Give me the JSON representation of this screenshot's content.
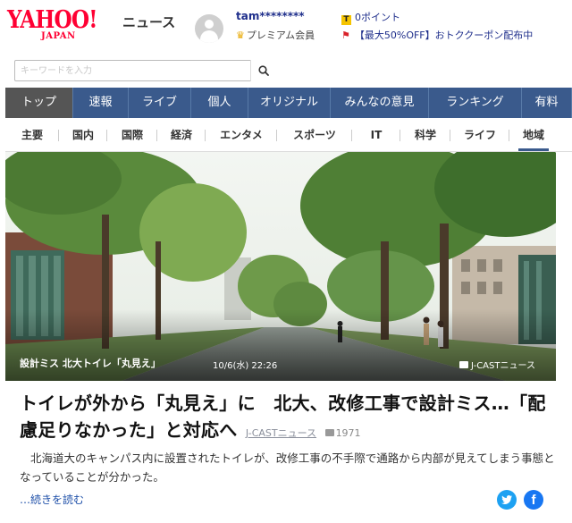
{
  "header": {
    "logo_text": "YAHOO!",
    "logo_sub": "JAPAN",
    "service_name": "ニュース",
    "username": "tam********",
    "premium_label": "プレミアム会員",
    "points_label": "0ポイント",
    "coupon_label": "【最大50%OFF】おトククーポン配布中"
  },
  "search": {
    "placeholder": "キーワードを入力"
  },
  "main_nav": {
    "items": [
      "トップ",
      "速報",
      "ライブ",
      "個人",
      "オリジナル",
      "みんなの意見",
      "ランキング",
      "有料"
    ],
    "active": "トップ"
  },
  "category_nav": {
    "items": [
      "主要",
      "国内",
      "国際",
      "経済",
      "エンタメ",
      "スポーツ",
      "IT",
      "科学",
      "ライフ",
      "地域"
    ],
    "active": "地域"
  },
  "photo": {
    "caption": "設計ミス 北大トイレ「丸見え」",
    "date": "10/6(水) 22:26",
    "source": "J-CASTニュース"
  },
  "article": {
    "headline": "トイレが外から「丸見え」に　北大、改修工事で設計ミス…「配慮足りなかった」と対応へ",
    "source": "J-CASTニュース",
    "comment_count": "1971",
    "summary": "北海道大のキャンパス内に設置されたトイレが、改修工事の不手際で通路から内部が見えてしまう事態となっていることが分かった。",
    "read_more": "…続きを読む"
  },
  "colors": {
    "brand_red": "#ff0033",
    "nav_blue": "#3a5a8c",
    "nav_active": "#555555",
    "link_blue": "#1e2e8b",
    "twitter": "#1da1f2",
    "facebook": "#1877f2"
  }
}
